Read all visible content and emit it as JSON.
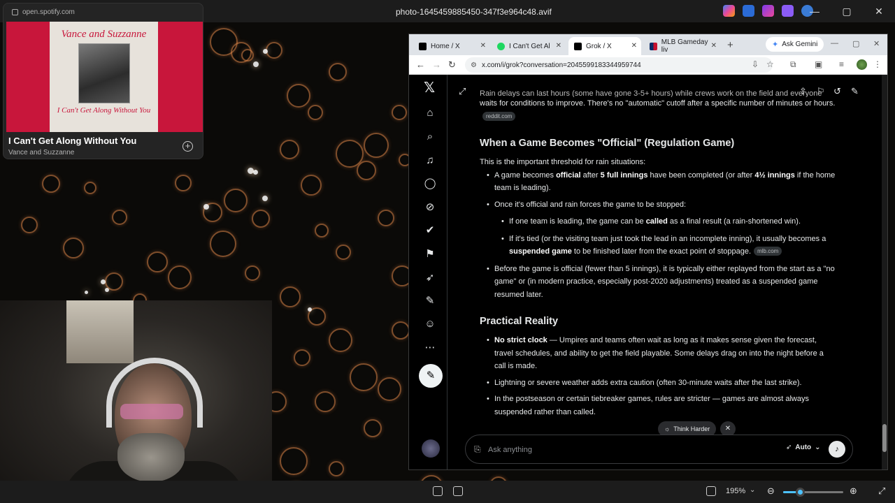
{
  "viewer": {
    "title": "photo-1645459885450-347f3e964c48.avif",
    "zoom": "195%",
    "zoom_fraction": 0.28,
    "window_controls": {
      "minimize": "—",
      "maximize": "▢",
      "close": "✕"
    }
  },
  "mini_player": {
    "url": "open.spotify.com",
    "album_art_top": "Vance and Suzzanne",
    "album_art_bottom": "I Can't Get Along Without You",
    "song_title": "I Can't Get Along Without You",
    "artist": "Vance and Suzzanne",
    "add_glyph": "+"
  },
  "browser": {
    "tabs": [
      {
        "label": "Home / X",
        "favicon": "x-icon",
        "active": false
      },
      {
        "label": "I Can't Get Al",
        "favicon": "spotify-icon",
        "active": false
      },
      {
        "label": "Grok / X",
        "favicon": "x-icon",
        "active": true
      },
      {
        "label": "MLB Gameday liv",
        "favicon": "mlb-icon",
        "active": false
      }
    ],
    "new_tab": "+",
    "ask_gemini": "Ask Gemini",
    "url": "x.com/i/grok?conversation=2045599183344959744"
  },
  "x": {
    "logo": "𝕏",
    "input_placeholder": "Ask anything",
    "mode_label": "Auto",
    "think_harder": "Think Harder"
  },
  "article": {
    "cut_line": "Rain delays can last hours (some have gone 3-5+ hours) while crews work on the field and everyone",
    "intro_cont": "waits for conditions to improve. There's no \"automatic\" cutoff after a specific number of minutes or hours.",
    "src1": "reddit.com",
    "h_official": "When a Game Becomes \"Official\" (Regulation Game)",
    "threshold": "This is the important threshold for rain situations:",
    "b1_pre": "A game becomes ",
    "b1_official": "official",
    "b1_mid": " after ",
    "b1_five": "5 full innings",
    "b1_mid2": " have been completed (or after ",
    "b1_four": "4½ innings",
    "b1_post": " if the home team is leading).",
    "b2": "Once it's official and rain forces the game to be stopped:",
    "s1_pre": "If one team is leading, the game can be ",
    "s1_called": "called",
    "s1_post": " as a final result (a rain-shortened win).",
    "s2_pre": "If it's tied (or the visiting team just took the lead in an incomplete inning), it usually becomes a ",
    "s2_suspended": "suspended game",
    "s2_post": " to be finished later from the exact point of stoppage.",
    "src2": "mlb.com",
    "b3": "Before the game is official (fewer than 5 innings), it is typically either replayed from the start as a \"no game\" or (in modern practice, especially post-2020 adjustments) treated as a suspended game resumed later.",
    "h_practical": "Practical Reality",
    "p1_bold": "No strict clock",
    "p1_rest": " — Umpires and teams often wait as long as it makes sense given the forecast, travel schedules, and ability to get the field playable. Some delays drag on into the night before a call is made.",
    "p2": "Lightning or severe weather adds extra caution (often 30-minute waits after the last strike).",
    "p3": "In the postseason or certain tiebreaker games, rules are stricter — games are almost always suspended rather than called."
  }
}
